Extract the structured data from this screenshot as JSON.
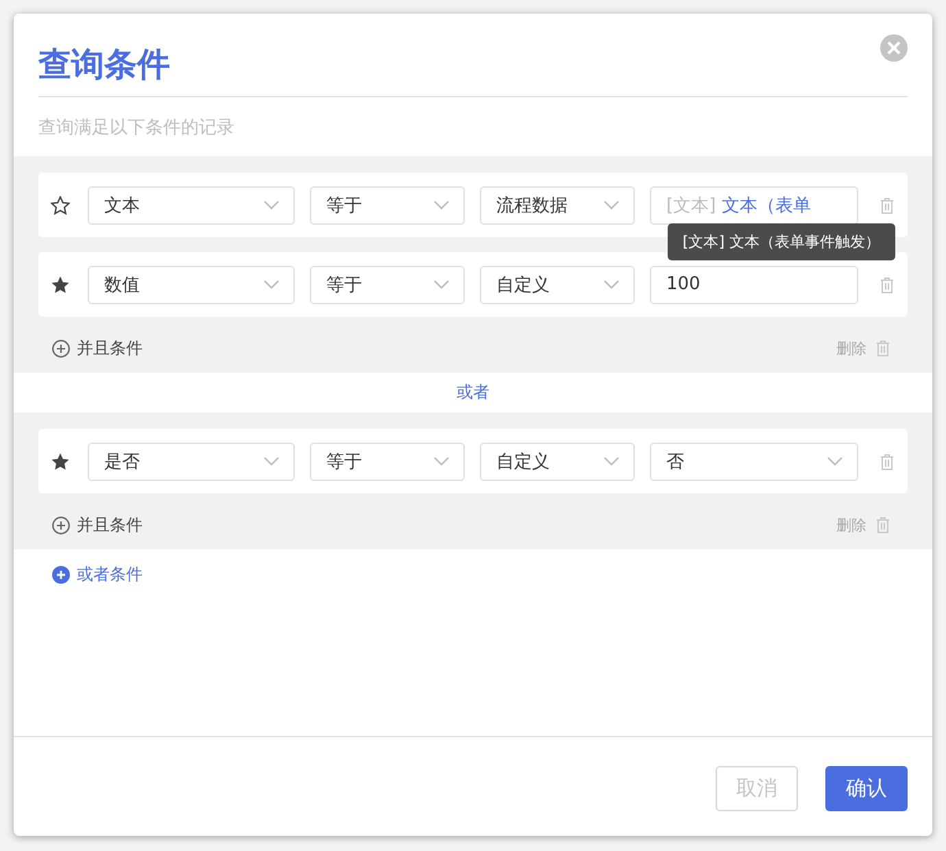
{
  "dialog": {
    "title": "查询条件",
    "subtitle": "查询满足以下条件的记录"
  },
  "groups": [
    {
      "conditions": [
        {
          "starred": false,
          "field": "文本",
          "operator": "等于",
          "source": "流程数据",
          "value": {
            "kind": "reference",
            "prefix": "[文本]",
            "text": "文本（表单"
          },
          "tooltip": "[文本] 文本（表单事件触发）"
        },
        {
          "starred": true,
          "field": "数值",
          "operator": "等于",
          "source": "自定义",
          "value": {
            "kind": "input",
            "text": "100"
          }
        }
      ],
      "add_and": "并且条件",
      "delete": "删除"
    },
    {
      "conditions": [
        {
          "starred": true,
          "field": "是否",
          "operator": "等于",
          "source": "自定义",
          "value": {
            "kind": "select",
            "text": "否"
          }
        }
      ],
      "add_and": "并且条件",
      "delete": "删除"
    }
  ],
  "or_separator": "或者",
  "add_or": "或者条件",
  "buttons": [
    {
      "label": "取消",
      "kind": "secondary"
    },
    {
      "label": "确认",
      "kind": "primary"
    }
  ]
}
